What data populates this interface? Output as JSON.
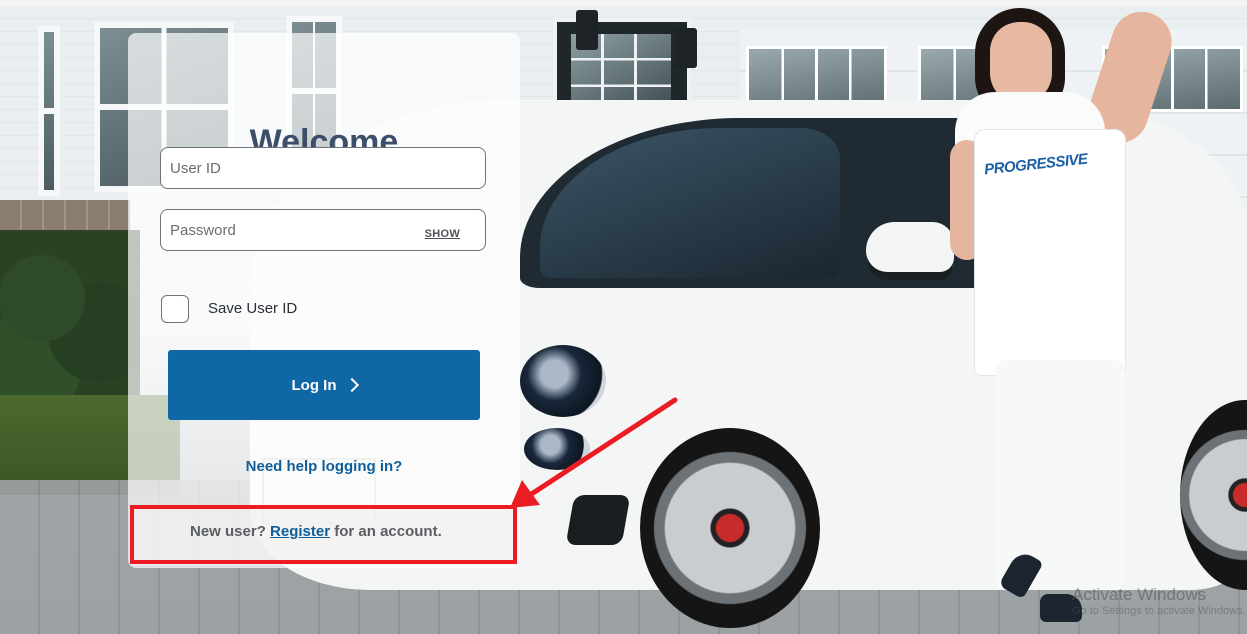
{
  "login": {
    "title": "Welcome",
    "user_id_placeholder": "User ID",
    "password_placeholder": "Password",
    "show_label": "SHOW",
    "save_user_id_label": "Save User ID",
    "save_user_id_checked": false,
    "login_button_label": "Log In",
    "help_link": "Need help logging in?",
    "footer": {
      "prefix": "New user?",
      "register_link": "Register",
      "suffix": "for an account."
    }
  },
  "scene": {
    "apron_logo": "PROGRESSIVE",
    "watermark": "Activate Windows",
    "watermark_sub": "Go to Settings to activate Windows."
  },
  "annotation": {
    "color": "#ec1c24",
    "target": "register-footer"
  },
  "colors": {
    "primary_button": "#0f67a6",
    "link": "#0f5e99",
    "title": "#3b4f6b"
  },
  "icons": {
    "login_chevron": "chevron-right-icon"
  }
}
